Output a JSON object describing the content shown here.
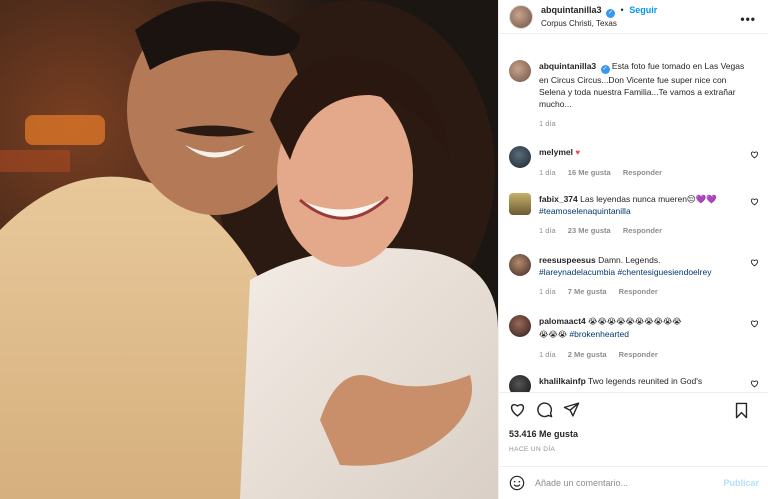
{
  "post": {
    "username": "abquintanilla3",
    "follow_label": "Seguir",
    "separator": "•",
    "location": "Corpus Christi, Texas",
    "more_label": "•••",
    "caption": "Esta foto fue tomado en Las Vegas en Circus Circus...Don Vicente fue super nice con Selena y toda nuestra Familia...Te vamos a extrañar mucho...",
    "caption_age": "1 día",
    "likes": "53.416 Me gusta",
    "timestamp": "HACE UN DÍA"
  },
  "comments": [
    {
      "user": "melymel",
      "text": "♥",
      "age": "1 día",
      "likes": "16 Me gusta",
      "reply": "Responder"
    },
    {
      "user": "fabix_374",
      "text": "Las leyendas nunca mueren😔💜💜",
      "tags": "#teamoselenaquintanilla",
      "age": "1 día",
      "likes": "23 Me gusta",
      "reply": "Responder"
    },
    {
      "user": "reesuspeesus",
      "text": "Damn. Legends.",
      "tags": "#lareynadelacumbia #chentesiguesiendoelrey",
      "age": "1 día",
      "likes": "7 Me gusta",
      "reply": "Responder"
    },
    {
      "user": "palomaact4",
      "text": "😭😭😭😭😭😭😭😭😭😭",
      "text2": "😭😭😭",
      "tags": "#brokenhearted",
      "age": "1 día",
      "likes": "2 Me gusta",
      "reply": "Responder"
    },
    {
      "user": "khalilkainfp",
      "text": "Two legends reunited in God's"
    }
  ],
  "compose": {
    "placeholder": "Añade un comentario...",
    "publish_label": "Publicar"
  },
  "icons": [
    "heart-icon",
    "comment-icon",
    "share-icon",
    "save-icon",
    "emoji-icon",
    "verified-icon"
  ],
  "colors": {
    "link": "#0095f6",
    "hashtag": "#00376b",
    "muted": "#8e8e8e",
    "heart": "#ed4956"
  }
}
